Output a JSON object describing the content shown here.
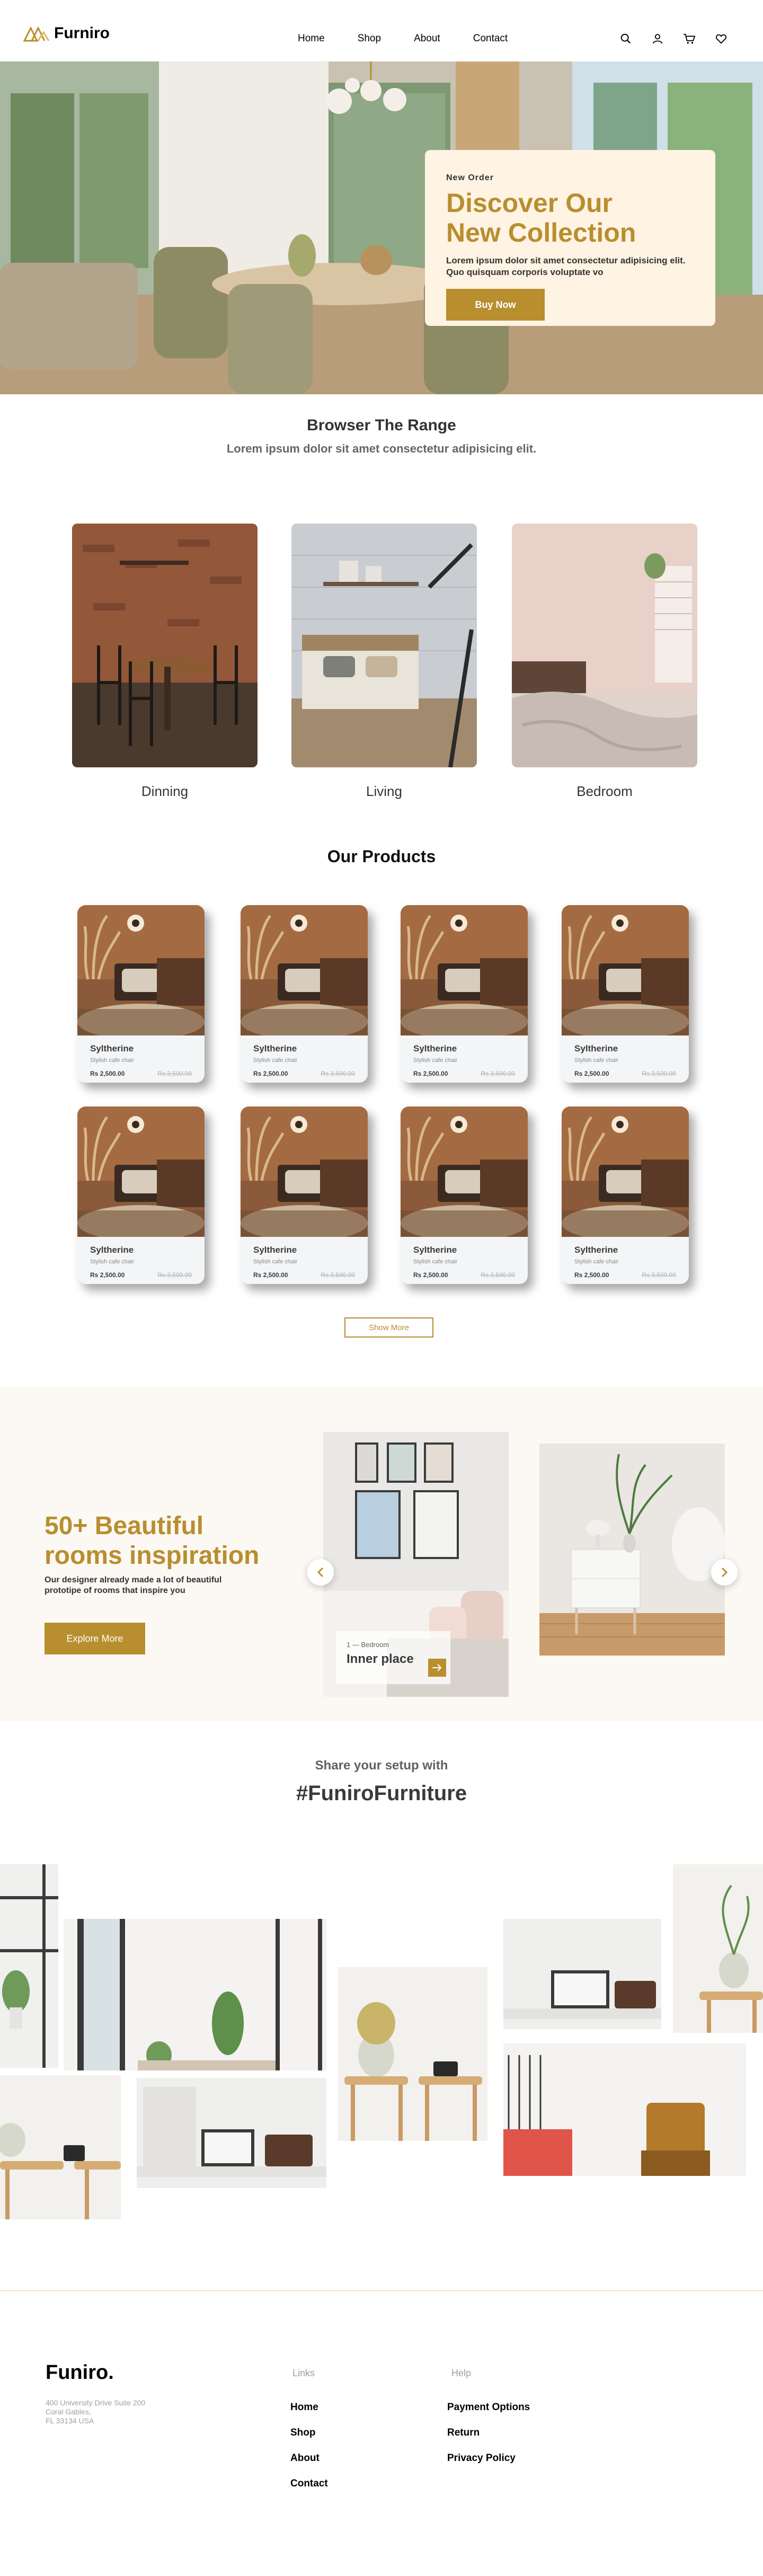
{
  "header": {
    "brand": "Furniro",
    "nav": [
      "Home",
      "Shop",
      "About",
      "Contact"
    ],
    "icons": [
      "search-icon",
      "user-icon",
      "cart-icon",
      "heart-icon"
    ]
  },
  "hero": {
    "eyebrow": "New Order",
    "title_line1": "Discover Our",
    "title_line2": "New Collection",
    "desc_line1": "Lorem ipsum dolor sit amet consectetur adipisicing elit.",
    "desc_line2": "Quo quisquam corporis voluptate vo",
    "button": "Buy Now"
  },
  "range": {
    "title": "Browser The Range",
    "subtitle": "Lorem ipsum dolor sit amet consectetur adipisicing elit.",
    "items": [
      "Dinning",
      "Living",
      "Bedroom"
    ]
  },
  "products": {
    "title": "Our Products",
    "items": [
      {
        "name": "Syltherine",
        "desc": "Stylish cafe chair",
        "price": "Rs 2,500.00",
        "old": "Rs 3,500.00"
      },
      {
        "name": "Syltherine",
        "desc": "Stylish cafe chair",
        "price": "Rs 2,500.00",
        "old": "Rs 3,500.00"
      },
      {
        "name": "Syltherine",
        "desc": "Stylish cafe chair",
        "price": "Rs 2,500.00",
        "old": "Rs 3,500.00"
      },
      {
        "name": "Syltherine",
        "desc": "Stylish cafe chair",
        "price": "Rs 2,500.00",
        "old": "Rs 3,500.00"
      },
      {
        "name": "Syltherine",
        "desc": "Stylish cafe chair",
        "price": "Rs 2,500.00",
        "old": "Rs 3,500.00"
      },
      {
        "name": "Syltherine",
        "desc": "Stylish cafe chair",
        "price": "Rs 2,500.00",
        "old": "Rs 3,500.00"
      },
      {
        "name": "Syltherine",
        "desc": "Stylish cafe chair",
        "price": "Rs 2,500.00",
        "old": "Rs 3,500.00"
      },
      {
        "name": "Syltherine",
        "desc": "Stylish cafe chair",
        "price": "Rs 2,500.00",
        "old": "Rs 3,500.00"
      }
    ],
    "show_more": "Show More"
  },
  "inspiration": {
    "title_line1": "50+ Beautiful",
    "title_line2": "rooms inspiration",
    "desc": "Our designer already made a lot of beautiful prototipe of rooms that inspire you",
    "button": "Explore More",
    "slide_tag": "1 — Bedroom",
    "slide_title": "Inner place"
  },
  "setup": {
    "subtitle": "Share your setup with",
    "hashtag": "#FuniroFurniture"
  },
  "footer": {
    "brand": "Funiro.",
    "address_line1": "400 University Drive Suite 200",
    "address_line2": "Coral Gables,",
    "address_line3": "FL 33134 USA",
    "links_title": "Links",
    "links": [
      "Home",
      "Shop",
      "About",
      "Contact"
    ],
    "help_title": "Help",
    "help": [
      "Payment Options",
      "Return",
      "Privacy Policy"
    ]
  },
  "colors": {
    "accent": "#b88e2f",
    "hero_card": "#fff3e3",
    "inspiration_bg": "#fcf8f3"
  }
}
